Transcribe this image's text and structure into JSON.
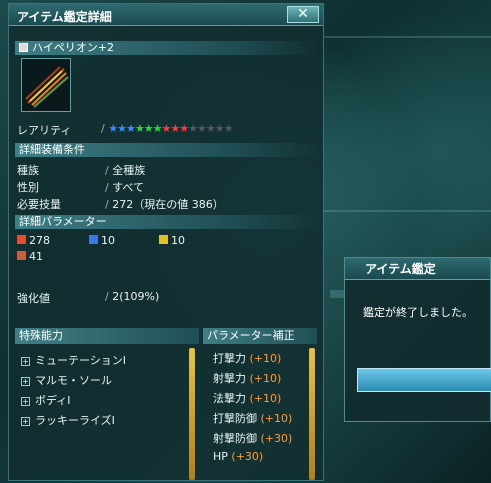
{
  "window": {
    "title": "アイテム鑑定詳細",
    "close": "✕"
  },
  "item": {
    "name": "ハイペリオン+2",
    "rarity_label": "レアリティ",
    "rarity_stars": 13,
    "rarity_max": 13
  },
  "equip": {
    "section": "詳細装備条件",
    "rows": [
      {
        "label": "種族",
        "value": "全種族"
      },
      {
        "label": "性別",
        "value": "すべて"
      },
      {
        "label": "必要技量",
        "value": "272（現在の値 386）"
      }
    ]
  },
  "params": {
    "section": "詳細パラメーター",
    "melee": "278",
    "ranged": "10",
    "tech": "10",
    "special": "41"
  },
  "grind": {
    "label": "強化値",
    "value": "2(109%)"
  },
  "abilities": {
    "section": "特殊能力",
    "items": [
      "ミューテーションⅠ",
      "マルモ・ソール",
      "ボディⅠ",
      "ラッキーライズⅠ"
    ]
  },
  "bonus": {
    "section": "パラメーター補正",
    "items": [
      {
        "label": "打撃力",
        "value": "(+10)"
      },
      {
        "label": "射撃力",
        "value": "(+10)"
      },
      {
        "label": "法撃力",
        "value": "(+10)"
      },
      {
        "label": "打撃防御",
        "value": "(+10)"
      },
      {
        "label": "射撃防御",
        "value": "(+30)"
      },
      {
        "label": "HP",
        "value": "(+30)"
      }
    ]
  },
  "popup": {
    "title": "アイテム鑑定",
    "message": "鑑定が終了しました。"
  },
  "colors": {
    "star_blue": "#3a8cff",
    "star_green": "#37d04a",
    "star_red": "#ff3a3a",
    "star_empty": "#556",
    "accent_orange": "#ff9a3c"
  }
}
